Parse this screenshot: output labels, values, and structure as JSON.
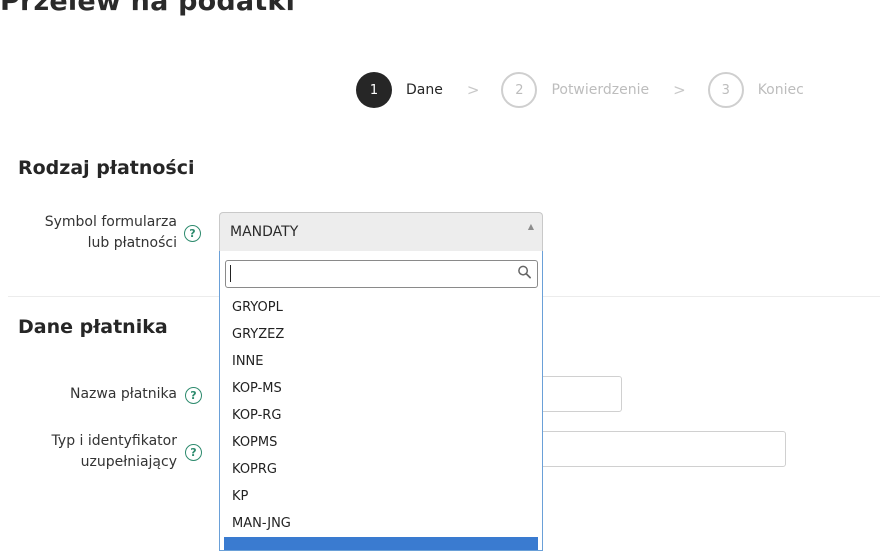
{
  "page": {
    "title": "Przelew na podatki"
  },
  "stepper": {
    "steps": [
      {
        "number": "1",
        "label": "Dane",
        "state": "active"
      },
      {
        "number": "2",
        "label": "Potwierdzenie",
        "state": "inactive"
      },
      {
        "number": "3",
        "label": "Koniec",
        "state": "inactive"
      }
    ],
    "separator": ">"
  },
  "payment_type": {
    "title": "Rodzaj płatności",
    "form_symbol": {
      "label_line1": "Symbol formularza",
      "label_line2": "lub płatności",
      "help": "?",
      "selected_value": "MANDATY",
      "search_value": "",
      "options": [
        "GRYOPL",
        "GRYZEZ",
        "INNE",
        "KOP-MS",
        "KOP-RG",
        "KOPMS",
        "KOPRG",
        "KP",
        "MAN-JNG",
        ""
      ]
    }
  },
  "payer": {
    "title": "Dane płatnika",
    "name_field": {
      "label": "Nazwa płatnika",
      "help": "?",
      "value": ""
    },
    "id_field": {
      "label_line1": "Typ i identyfikator",
      "label_line2": "uzupełniający",
      "help": "?",
      "value": ""
    }
  },
  "colors": {
    "accent_green": "#2e8b6e",
    "highlight_blue": "#3a7bd0",
    "step_active": "#262626"
  }
}
